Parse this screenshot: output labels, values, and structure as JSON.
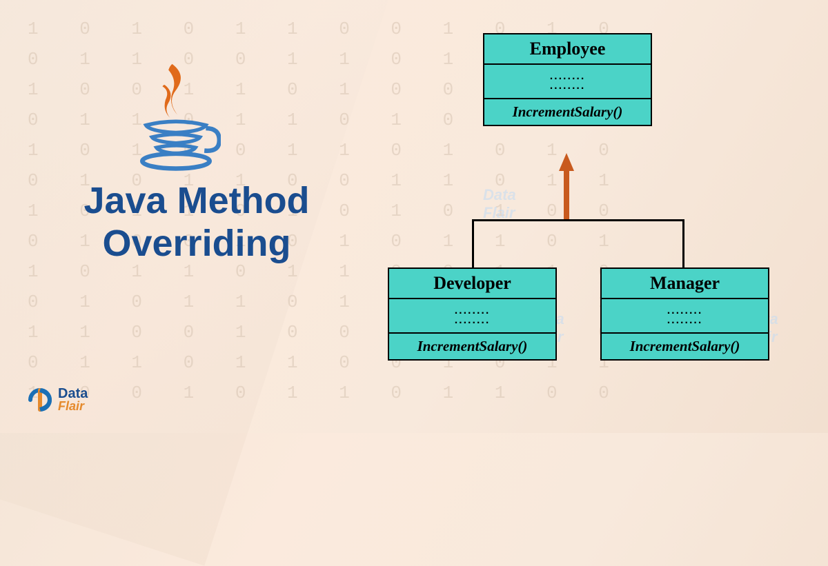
{
  "title_line1": "Java Method",
  "title_line2": "Overriding",
  "uml": {
    "parent": {
      "name": "Employee",
      "attrs_placeholder_1": "........",
      "attrs_placeholder_2": "........",
      "method": "IncrementSalary()"
    },
    "child1": {
      "name": "Developer",
      "attrs_placeholder_1": "........",
      "attrs_placeholder_2": "........",
      "method": "IncrementSalary()"
    },
    "child2": {
      "name": "Manager",
      "attrs_placeholder_1": "........",
      "attrs_placeholder_2": "........",
      "method": "IncrementSalary()"
    }
  },
  "brand": {
    "name_top": "Data",
    "name_bottom": "Flair"
  },
  "bg_binary": "1 0 1 0 1 1 0 0 1 0 1 0\n0 1 1 0 0 1 1 0 1 1 0 1\n1 0 0 1 1 0 1 0 0 1 1 0\n0 1 1 0 1 1 0 1 0 1 0 1\n1 0 1 0 0 1 1 0 1 0 1 0\n0 1 0 1 1 0 0 1 1 0 1 1\n1 0 1 1 0 1 0 1 0 1 0 0\n0 1 0 0 1 0 1 0 1 1 0 1\n1 0 1 1 0 1 1 0 0 1 1 0\n0 1 0 1 1 0 1 1 0 1 0 1\n1 1 0 0 1 0 0 1 1 0 1 0\n0 1 1 0 1 1 0 0 1 0 1 1\n1 0 0 1 0 1 1 0 1 1 0 0"
}
